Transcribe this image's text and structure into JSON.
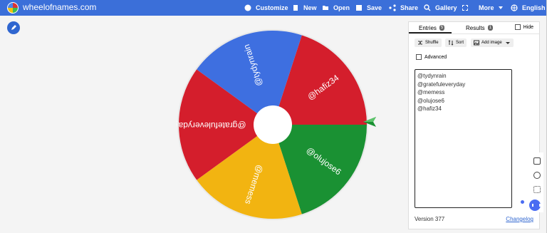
{
  "site": {
    "name": "wheelofnames.com"
  },
  "nav": {
    "customize": "Customize",
    "new": "New",
    "open": "Open",
    "save": "Save",
    "share": "Share",
    "gallery": "Gallery",
    "more": "More",
    "language": "English"
  },
  "panel": {
    "tabs": {
      "entries_label": "Entries",
      "entries_count": "5",
      "results_label": "Results",
      "results_count": "1",
      "hide": "Hide"
    },
    "buttons": {
      "shuffle": "Shuffle",
      "sort": "Sort",
      "add_image": "Add image",
      "advanced": "Advanced"
    },
    "entries": [
      "@tydynrain",
      "@gratefuleveryday",
      "@memess",
      "@olujose6",
      "@hafiz34"
    ],
    "version": "Version 377",
    "changelog": "Changelog"
  },
  "wheel": {
    "slices": [
      {
        "label": "@hafiz34",
        "color": "#d41e2c"
      },
      {
        "label": "@olujose6",
        "color": "#1a9133"
      },
      {
        "label": "@memess",
        "color": "#f2b411"
      },
      {
        "label": "@gratefuleveryday",
        "color": "#d41e2c"
      },
      {
        "label": "@tydynrain",
        "color": "#3e6fe0"
      }
    ]
  },
  "icons": [
    "palette-icon",
    "new-file-icon",
    "folder-icon",
    "save-icon",
    "share-icon",
    "search-icon",
    "fullscreen-icon",
    "chevron-down-icon",
    "globe-icon",
    "pencil-icon",
    "shuffle-icon",
    "sort-icon",
    "image-icon",
    "book-icon",
    "settings-icon",
    "grid-icon",
    "chat-icon",
    "pointer-icon"
  ]
}
